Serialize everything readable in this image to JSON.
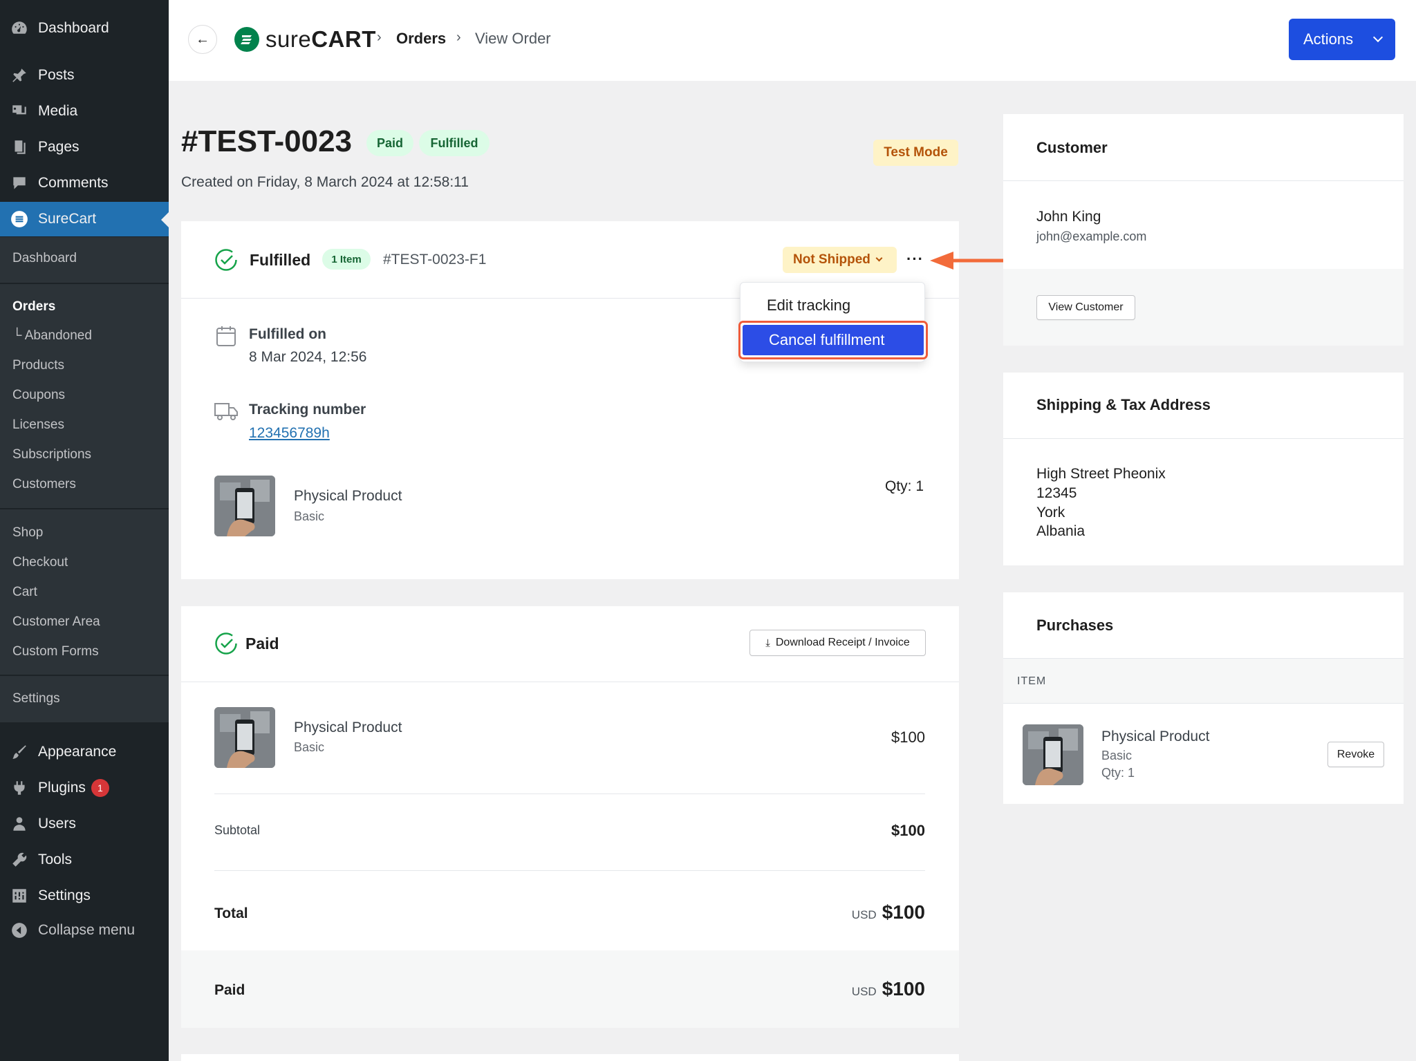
{
  "sidebar": {
    "top_items": [
      {
        "label": "Dashboard",
        "icon": "dashboard-icon"
      },
      {
        "label": "Posts",
        "icon": "pin-icon"
      },
      {
        "label": "Media",
        "icon": "media-icon"
      },
      {
        "label": "Pages",
        "icon": "pages-icon"
      },
      {
        "label": "Comments",
        "icon": "comment-icon"
      },
      {
        "label": "SureCart",
        "icon": "surecart-icon"
      }
    ],
    "submenu": [
      "Dashboard",
      "Orders",
      "└ Abandoned",
      "Products",
      "Coupons",
      "Licenses",
      "Subscriptions",
      "Customers",
      "Shop",
      "Checkout",
      "Cart",
      "Customer Area",
      "Custom Forms",
      "Settings"
    ],
    "bottom_items": [
      {
        "label": "Appearance",
        "icon": "brush-icon"
      },
      {
        "label": "Plugins",
        "icon": "plug-icon",
        "badge": "1"
      },
      {
        "label": "Users",
        "icon": "user-icon"
      },
      {
        "label": "Tools",
        "icon": "wrench-icon"
      },
      {
        "label": "Settings",
        "icon": "settings-icon"
      },
      {
        "label": "Collapse menu",
        "icon": "collapse-icon"
      }
    ]
  },
  "topbar": {
    "logo_light": "sure",
    "logo_bold": "CART",
    "breadcrumb": [
      "Orders",
      "View Order"
    ],
    "actions_label": "Actions"
  },
  "order": {
    "number": "#TEST-0023",
    "status_paid": "Paid",
    "status_fulfilled": "Fulfilled",
    "created": "Created on Friday, 8 March 2024 at 12:58:11",
    "test_mode": "Test Mode"
  },
  "fulfillment": {
    "title": "Fulfilled",
    "items_badge": "1 Item",
    "id": "#TEST-0023-F1",
    "shipping_status": "Not Shipped",
    "menu": {
      "edit": "Edit tracking",
      "cancel": "Cancel fulfillment"
    },
    "fulfilled_on_label": "Fulfilled on",
    "fulfilled_on_value": "8 Mar 2024, 12:56",
    "tracking_label": "Tracking number",
    "tracking_value": "123456789h",
    "product_name": "Physical Product",
    "product_variant": "Basic",
    "qty": "Qty: 1"
  },
  "payment": {
    "title": "Paid",
    "download_label": "Download Receipt / Invoice",
    "product_name": "Physical Product",
    "product_variant": "Basic",
    "product_price": "$100",
    "subtotal_label": "Subtotal",
    "subtotal_value": "$100",
    "total_label": "Total",
    "total_currency": "USD",
    "total_value": "$100",
    "paid_label": "Paid",
    "paid_currency": "USD",
    "paid_value": "$100"
  },
  "customer": {
    "title": "Customer",
    "name": "John King",
    "email": "john@example.com",
    "view_button": "View Customer"
  },
  "address": {
    "title": "Shipping & Tax Address",
    "lines": [
      "High Street Pheonix",
      "12345",
      "York",
      "Albania"
    ]
  },
  "purchases": {
    "title": "Purchases",
    "column": "ITEM",
    "product_name": "Physical Product",
    "product_variant": "Basic",
    "qty": "Qty: 1",
    "revoke": "Revoke"
  },
  "colors": {
    "accent": "#1d4ee0",
    "wp_blue": "#2271b1",
    "success": "#166534",
    "warning": "#b45309",
    "highlight": "#ef5b3a"
  }
}
